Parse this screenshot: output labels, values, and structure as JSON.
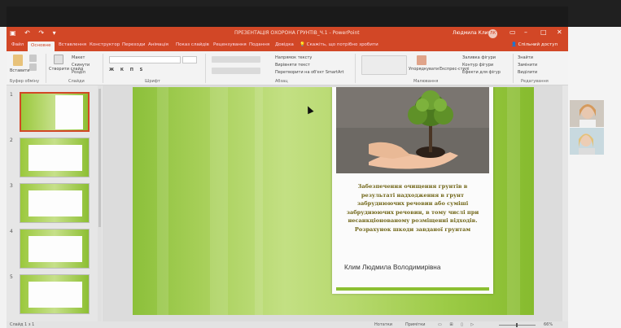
{
  "window": {
    "title": "ПРЕЗЕНТАЦІЯ ОХОРОНА ГРУНТІВ_Ч.1 - PowerPoint",
    "user": "Людмила Клим",
    "user_initials": "ЛК"
  },
  "tabs": [
    "Файл",
    "Основне",
    "Вставлення",
    "Конструктор",
    "Переходи",
    "Анімація",
    "Показ слайдів",
    "Рецензування",
    "Подання",
    "Довідка"
  ],
  "active_tab": "Основне",
  "tell_me": "Скажіть, що потрібно зробити",
  "share": "Спільний доступ",
  "ribbon": {
    "paste": "Вставити",
    "new_slide": "Створити слайд",
    "layout": "Макет",
    "reset": "Скинути",
    "section": "Розділ",
    "text_direction": "Напрямок тексту",
    "align_text": "Вирівняти текст",
    "smartart": "Перетворити на об'єкт SmartArt",
    "arrange": "Упорядкувати",
    "quick_styles": "Експрес-стилі",
    "shape_fill": "Заливка фігури",
    "shape_outline": "Контур фігури",
    "shape_effects": "Ефекти для фігур",
    "find": "Знайти",
    "replace": "Замінити",
    "select": "Виділити",
    "groups": {
      "clipboard": "Буфер обміну",
      "slides": "Слайди",
      "font": "Шрифт",
      "paragraph": "Абзац",
      "drawing": "Малювання",
      "editing": "Редагування"
    }
  },
  "thumbnails": [
    {
      "num": "1",
      "selected": true
    },
    {
      "num": "2",
      "selected": false
    },
    {
      "num": "3",
      "selected": false
    },
    {
      "num": "4",
      "selected": false
    },
    {
      "num": "5",
      "selected": false
    }
  ],
  "slide": {
    "title": "Забезпечення очищення грунтів в результаті надходження в грунт забруднюючих речовин або суміші забруднюючих речовин, в тому числі при несанкціонованому розміщенні відходів. Розрахунок шкоди завданої грунтам",
    "author": "Клим Людмила Володимирівна"
  },
  "status": {
    "slide_of": "Слайд 1 з 1",
    "notes": "Нотатки",
    "comments": "Примітки",
    "zoom": "66%"
  },
  "colors": {
    "accent": "#d24726",
    "title_text": "#6f6415",
    "slide_green": "#9ccb46"
  }
}
